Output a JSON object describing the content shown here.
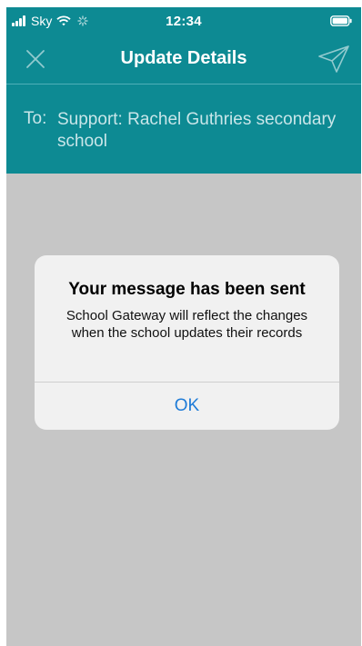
{
  "status_bar": {
    "carrier": "Sky",
    "time": "12:34",
    "signal_bars": 4,
    "icons": [
      "signal-icon",
      "wifi-icon",
      "spinner-icon",
      "battery-icon"
    ]
  },
  "nav": {
    "title": "Update Details",
    "left_icon": "close-icon",
    "right_icon": "send-icon"
  },
  "recipient": {
    "label": "To:",
    "value": "Support: Rachel Guthries secondary school"
  },
  "alert": {
    "title": "Your message has been sent",
    "message": "School Gateway will reflect the changes when the school updates their records",
    "button_label": "OK"
  },
  "colors": {
    "header": "#0d8a93",
    "overlay": "#c6c6c6",
    "alert_bg": "#f1f1f1",
    "link": "#1e7bd7"
  }
}
